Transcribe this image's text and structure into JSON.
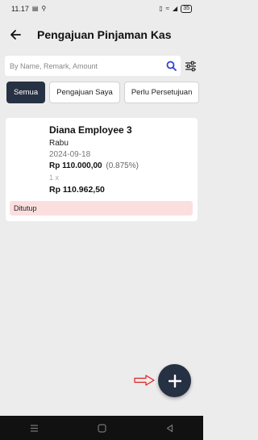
{
  "status_bar": {
    "time": "11.17",
    "battery": "35"
  },
  "header": {
    "title": "Pengajuan Pinjaman Kas"
  },
  "search": {
    "placeholder": "By Name, Remark, Amount",
    "value": ""
  },
  "tabs": [
    {
      "label": "Semua",
      "active": true
    },
    {
      "label": "Pengajuan Saya",
      "active": false
    },
    {
      "label": "Perlu Persetujuan",
      "active": false
    }
  ],
  "card": {
    "name": "Diana Employee 3",
    "day": "Rabu",
    "date": "2024-09-18",
    "amount": "Rp 110.000,00",
    "rate": "(0.875%)",
    "quantity": "1 x",
    "total": "Rp 110.962,50",
    "status": "Ditutup"
  },
  "colors": {
    "accent": "#263143",
    "status_closed_bg": "#fbdfdf",
    "annotation_arrow": "#e02020"
  },
  "icons": {
    "back": "arrow-left-icon",
    "search": "search-icon",
    "filter": "sliders-icon",
    "fab": "plus-icon",
    "annotation": "arrow-right-icon"
  }
}
